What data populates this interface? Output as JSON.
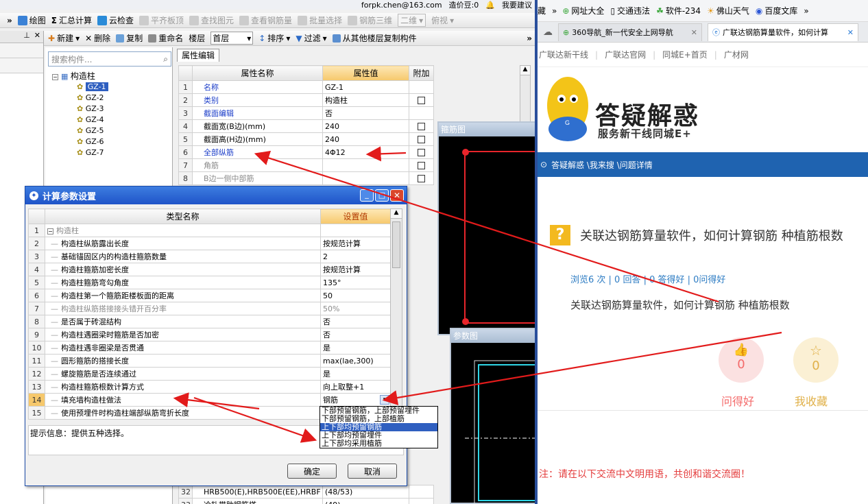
{
  "app": {
    "top_bar": {
      "user": "forpk.chen@163.com",
      "cost_beans": "造价豆:0",
      "feedback": "我要建议"
    },
    "toolbar1": [
      "绘图",
      "汇总计算",
      "云检查",
      "平齐板顶",
      "查找图元",
      "查看钢筋量",
      "批量选择",
      "钢筋三维"
    ],
    "toolbar1_view": "二维",
    "toolbar1_view2": "俯视",
    "toolbar2": {
      "new": "新建",
      "delete": "删除",
      "copy": "复制",
      "rename": "重命名",
      "floor_label": "楼层",
      "floor_value": "首层",
      "sort": "排序",
      "filter": "过滤",
      "copy_from": "从其他楼层复制构件"
    },
    "search_placeholder": "搜索构件...",
    "tree": {
      "root": "构造柱",
      "items": [
        "GZ-1",
        "GZ-2",
        "GZ-3",
        "GZ-4",
        "GZ-5",
        "GZ-6",
        "GZ-7"
      ]
    },
    "prop_tab": "属性编辑",
    "prop_headers": [
      "属性名称",
      "属性值",
      "附加"
    ],
    "prop_rows": [
      {
        "n": "1",
        "name": "名称",
        "value": "GZ-1",
        "blue": true,
        "chk": false
      },
      {
        "n": "2",
        "name": "类别",
        "value": "构造柱",
        "blue": true,
        "chk": true
      },
      {
        "n": "3",
        "name": "截面编辑",
        "value": "否",
        "blue": true,
        "chk": false
      },
      {
        "n": "4",
        "name": "截面宽(B边)(mm)",
        "value": "240",
        "blue": false,
        "chk": true
      },
      {
        "n": "5",
        "name": "截面高(H边)(mm)",
        "value": "240",
        "blue": false,
        "chk": true
      },
      {
        "n": "6",
        "name": "全部纵筋",
        "value": "4Φ12",
        "blue": true,
        "chk": true
      },
      {
        "n": "7",
        "name": "角筋",
        "value": "",
        "gray": true,
        "chk": true
      },
      {
        "n": "8",
        "name": "B边一侧中部筋",
        "value": "",
        "gray": true,
        "chk": true
      }
    ],
    "prop_bottom_rows": [
      {
        "n": "32",
        "name": "HRB500(E),HRB500E(EE),HRBF",
        "value": "(48/53)"
      },
      {
        "n": "33",
        "name": "冷轧带肋钢筋搭",
        "value": "(49)"
      }
    ],
    "panel_rebar": "箍筋图",
    "panel_param": "参数图"
  },
  "dialog": {
    "title": "计算参数设置",
    "headers": [
      "类型名称",
      "设置值"
    ],
    "rows": [
      {
        "n": "1",
        "name": "构造柱",
        "value": "",
        "group": true
      },
      {
        "n": "2",
        "name": "构造柱纵筋露出长度",
        "value": "按规范计算",
        "chk": true
      },
      {
        "n": "3",
        "name": "基础锚固区内的构造柱箍筋数量",
        "value": "2",
        "chk": false
      },
      {
        "n": "4",
        "name": "构造柱箍筋加密长度",
        "value": "按规范计算",
        "chk": true
      },
      {
        "n": "5",
        "name": "构造柱箍筋弯勾角度",
        "value": "135°",
        "chk": true
      },
      {
        "n": "6",
        "name": "构造柱第一个箍筋距楼板面的距离",
        "value": "50",
        "chk": true
      },
      {
        "n": "7",
        "name": "构造柱纵筋搭接接头错开百分率",
        "value": "50%",
        "gray": true,
        "chk": true
      },
      {
        "n": "8",
        "name": "是否属于砖混结构",
        "value": "否",
        "chk": true
      },
      {
        "n": "9",
        "name": "构造柱遇圈梁时箍筋是否加密",
        "value": "否",
        "chk": true
      },
      {
        "n": "10",
        "name": "构造柱遇非圈梁是否贯通",
        "value": "是",
        "chk": true
      },
      {
        "n": "11",
        "name": "圆形箍筋的搭接长度",
        "value": "max(lae,300)",
        "chk": true
      },
      {
        "n": "12",
        "name": "螺旋箍筋是否连续通过",
        "value": "是",
        "chk": true
      },
      {
        "n": "13",
        "name": "构造柱箍筋根数计算方式",
        "value": "向上取整+1",
        "chk": true
      },
      {
        "n": "14",
        "name": "填充墙构造柱做法",
        "value": "钢筋",
        "chk": true,
        "selected": true
      },
      {
        "n": "15",
        "name": "使用预埋件时构造柱端部纵筋弯折长度",
        "value": "",
        "chk": false
      }
    ],
    "dropdown": [
      "下部预留钢筋，上部预留埋件",
      "下部预留钢筋，上部植筋",
      "上下部均预留钢筋",
      "上下部均预留埋件",
      "上下部均采用植筋"
    ],
    "dropdown_selected": 2,
    "hint": "提示信息：提供五种选择。",
    "ok": "确定",
    "cancel": "取消"
  },
  "browser": {
    "bookmarks_lead": "藏",
    "bookmarks": [
      "网址大全",
      "交通违法",
      "软件-234",
      "佛山天气",
      "百度文库"
    ],
    "tabs": [
      "360导航_新一代安全上网导航",
      "广联达钢筋算量软件，如何计算"
    ],
    "sitenav": [
      "广联达新干线",
      "广联达官网",
      "同城E+首页",
      "广材网"
    ],
    "banner_title": "答疑解惑",
    "banner_sub": "服务新干线同城E+",
    "breadcrumb": "答疑解惑 \\我来搜 \\问题详情",
    "question_title": "关联达钢筋算量软件，如何计算钢筋 种植筋根数",
    "stats": "浏览6 次 | 0 回答 | 0 答得好 | 0问得好",
    "question_body": "关联达钢筋算量软件，如何计算钢筋  种植筋根数",
    "like_count": "0",
    "like_label": "问得好",
    "fav_count": "0",
    "fav_label": "我收藏",
    "notice": "注：请在以下交流中文明用语，共创和谐交流圈！"
  },
  "colors": {
    "arrow": "#e21b1b",
    "orange_header": "#f6c86c",
    "accent_blue": "#2d7cc3",
    "pink": "#f46a6a",
    "gold": "#e0b048"
  }
}
